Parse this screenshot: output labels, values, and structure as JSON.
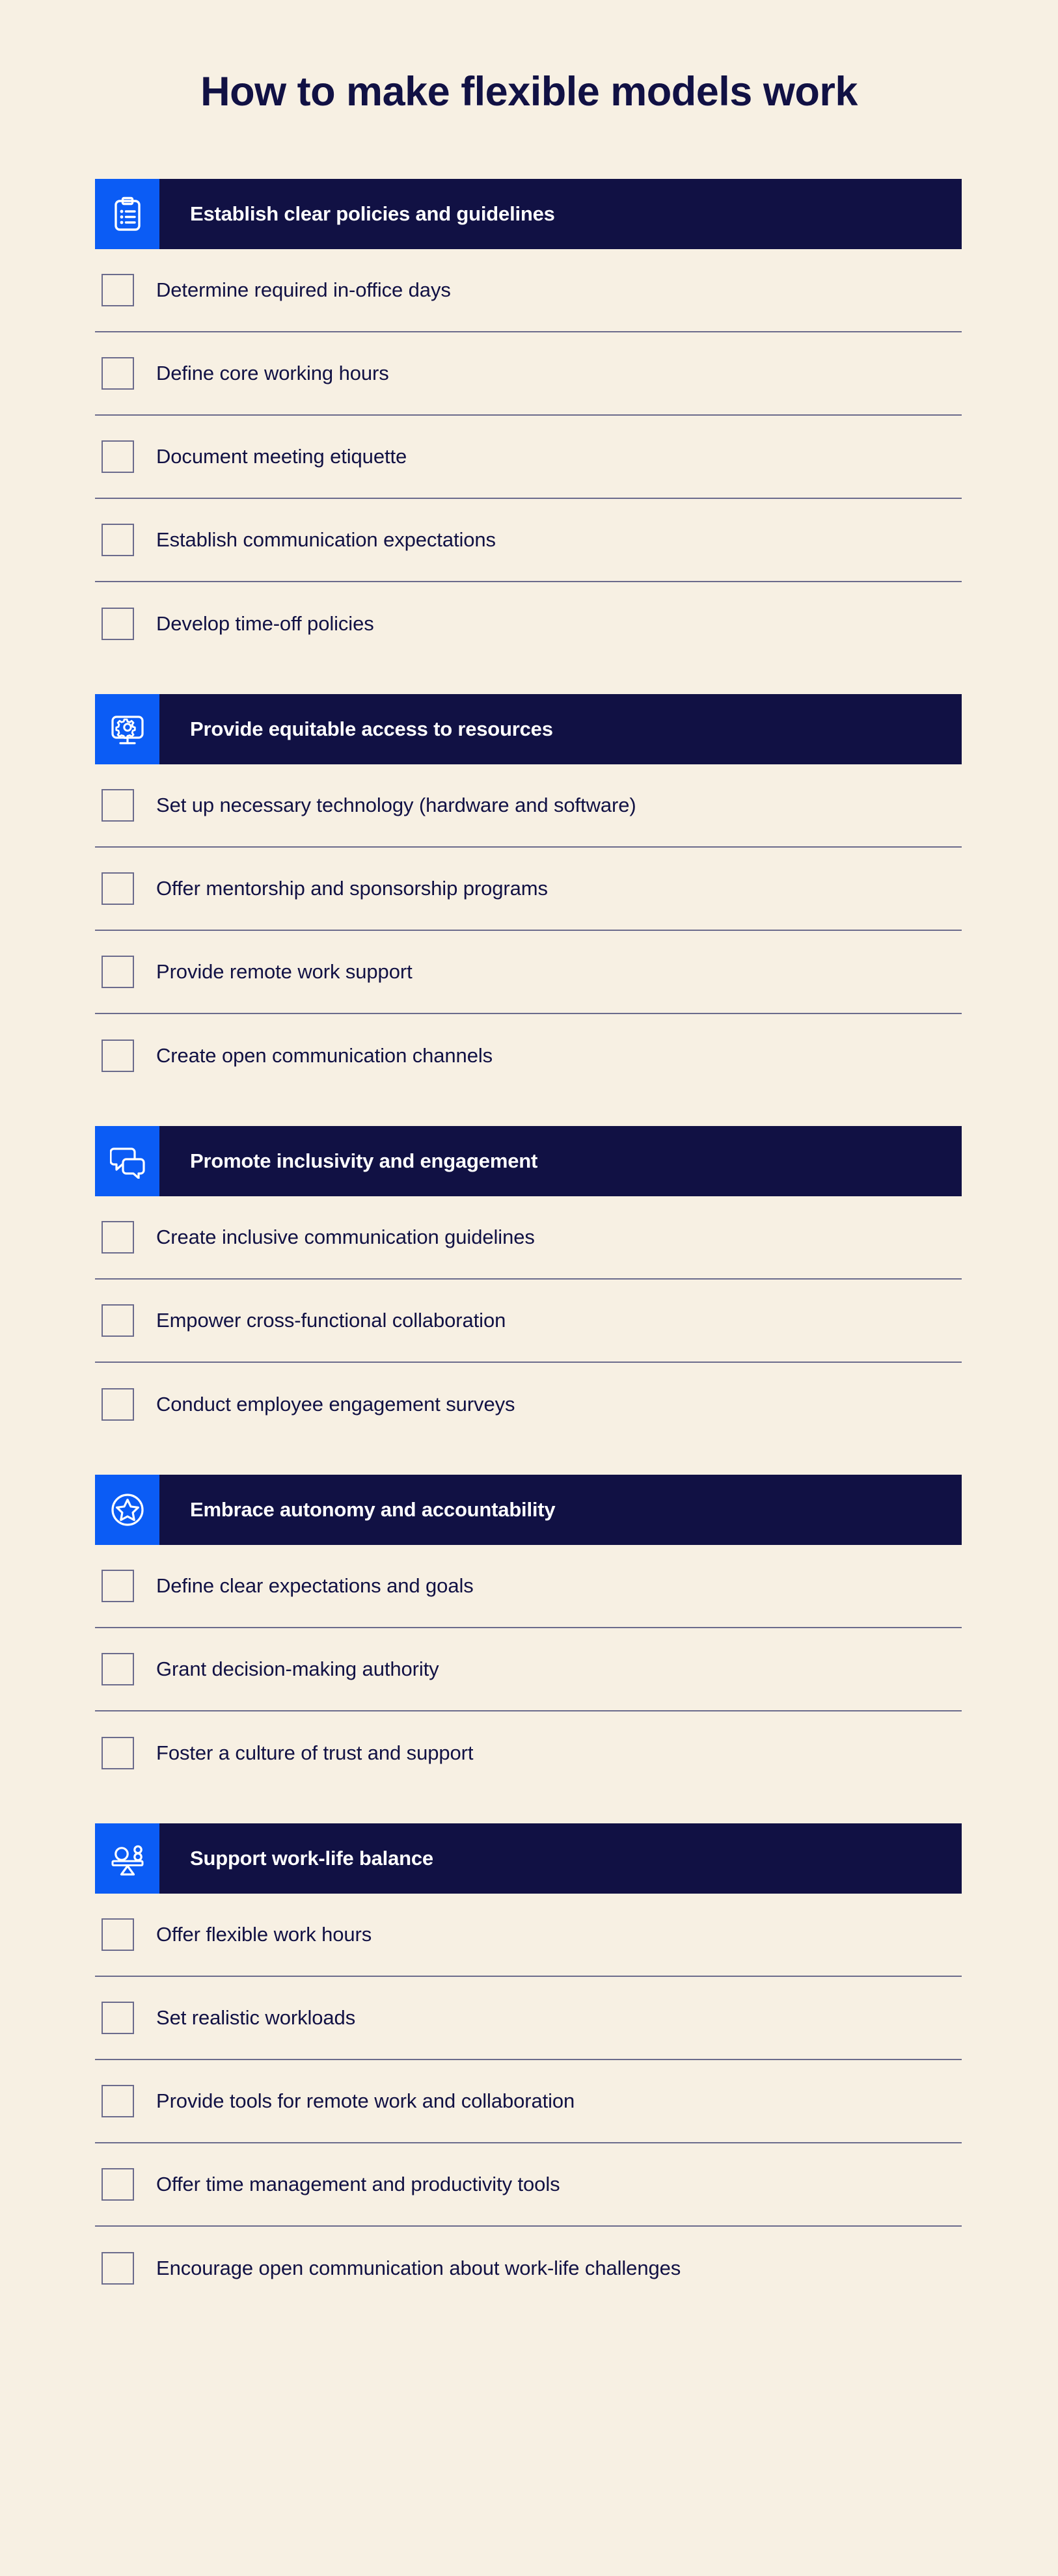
{
  "colors": {
    "background": "#F7F0E3",
    "navy": "#111144",
    "blue": "#0B5CF5",
    "white": "#FFFFFF",
    "rule": "#6B6B8C"
  },
  "title": "How to make flexible models work",
  "sections": [
    {
      "icon": "clipboard-checklist-icon",
      "title": "Establish clear policies and guidelines",
      "items": [
        "Determine required in-office days",
        "Define core working hours",
        "Document meeting etiquette",
        "Establish communication expectations",
        "Develop time-off policies"
      ]
    },
    {
      "icon": "monitor-gear-icon",
      "title": "Provide equitable access to resources",
      "items": [
        "Set up necessary technology (hardware and software)",
        "Offer mentorship and sponsorship programs",
        "Provide remote work support",
        "Create open communication channels"
      ]
    },
    {
      "icon": "speech-bubbles-icon",
      "title": "Promote inclusivity and engagement",
      "items": [
        "Create inclusive communication guidelines",
        "Empower cross-functional collaboration",
        "Conduct employee engagement surveys"
      ]
    },
    {
      "icon": "star-circle-icon",
      "title": "Embrace autonomy and accountability",
      "items": [
        "Define clear expectations and goals",
        "Grant decision-making authority",
        "Foster a culture of trust and support"
      ]
    },
    {
      "icon": "balance-scale-icon",
      "title": "Support work-life balance",
      "items": [
        "Offer flexible work hours",
        "Set realistic workloads",
        "Provide tools for remote work and collaboration",
        "Offer time management and productivity tools",
        "Encourage open communication about work-life challenges"
      ]
    }
  ]
}
